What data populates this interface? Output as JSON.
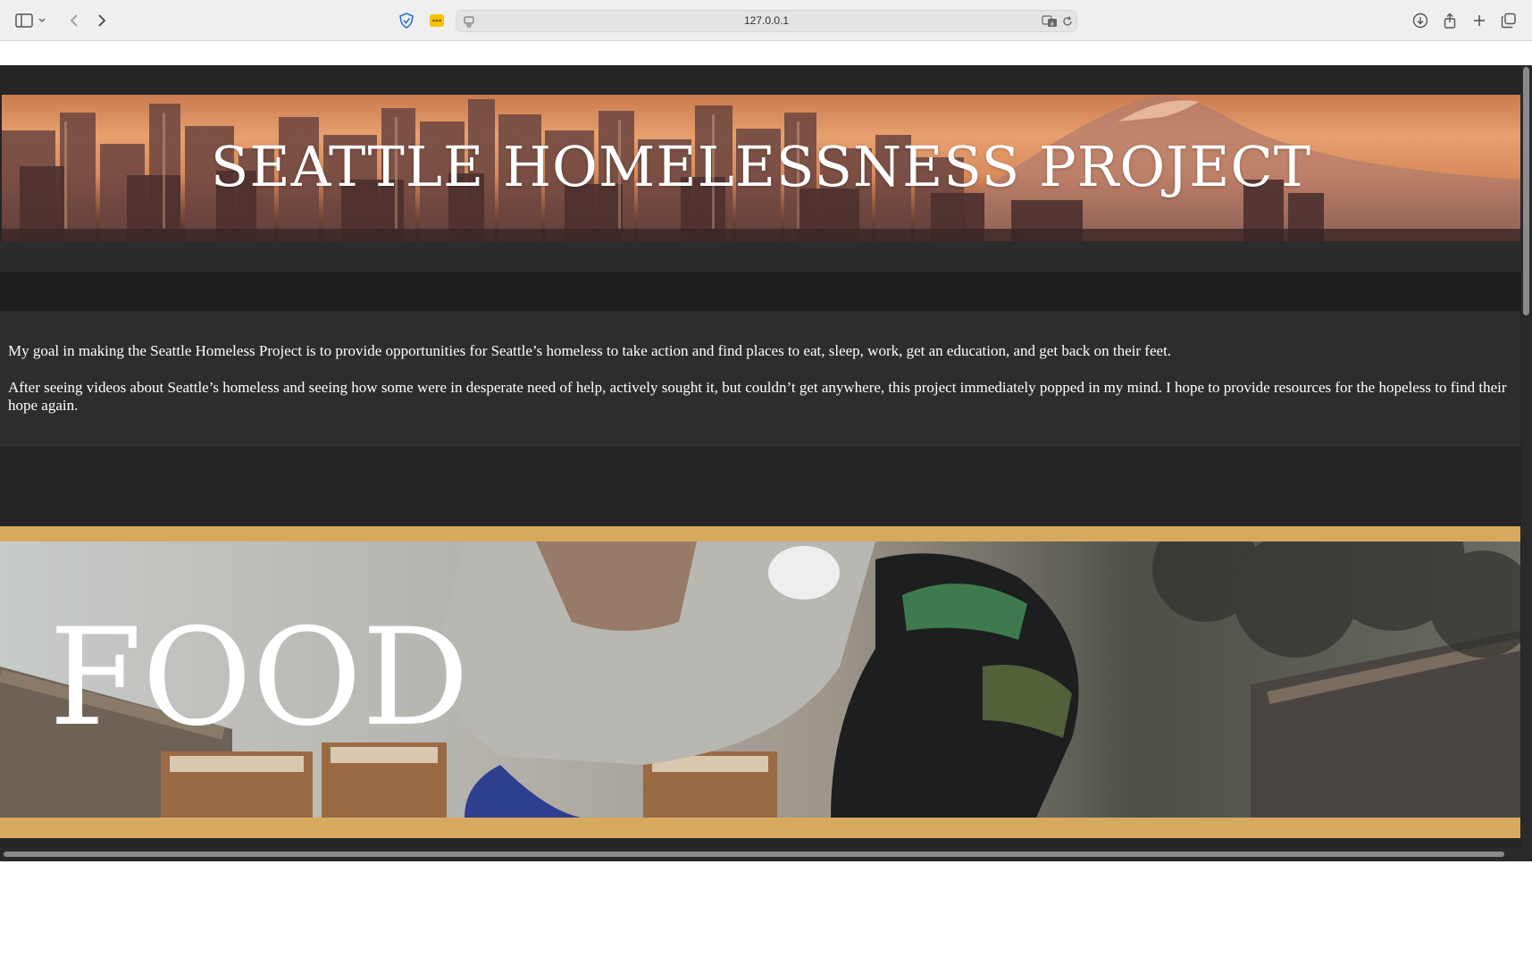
{
  "browser": {
    "url": "127.0.0.1",
    "icons": [
      "sidebar-toggle-icon",
      "chevron-down-icon",
      "back-icon",
      "forward-icon",
      "privacy-shield-icon",
      "extension-icon",
      "page-menu-icon",
      "translate-icon",
      "reload-icon",
      "download-icon",
      "share-icon",
      "new-tab-icon",
      "tab-overview-icon"
    ]
  },
  "hero": {
    "title": "SEATTLE HOMELESSNESS PROJECT"
  },
  "intro": {
    "paragraphs": [
      "My goal in making the Seattle Homeless Project is to provide opportunities for Seattle’s homeless to take action and find places to eat, sleep, work, get an education, and get back on their feet.",
      "After seeing videos about Seattle’s homeless and seeing how some were in desperate need of help, actively sought it, but couldn’t get anywhere, this project immediately popped in my mind. I hope to provide resources for the hopeless to find their hope again."
    ]
  },
  "sections": {
    "food": {
      "title": "FOOD"
    }
  },
  "colors": {
    "page_bg": "#252527",
    "accent_frame": "#d7a95e",
    "text": "#ffffff"
  }
}
